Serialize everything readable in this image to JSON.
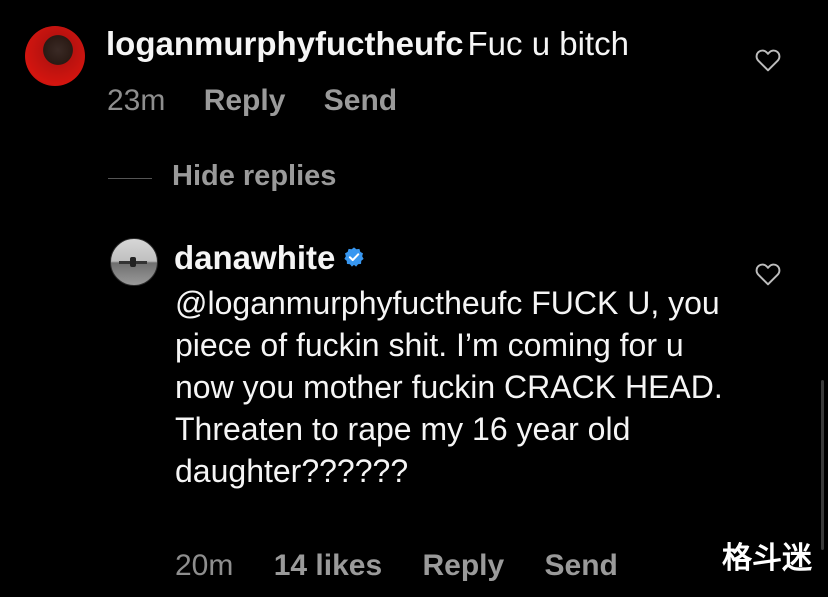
{
  "comment1": {
    "username": "loganmurphyfuctheufc",
    "text": "Fuc u bitch",
    "time": "23m",
    "reply_label": "Reply",
    "send_label": "Send"
  },
  "hide_replies_label": "Hide replies",
  "comment2": {
    "username": "danawhite",
    "verified": true,
    "text": "@loganmurphyfuctheufc FUCK U, you piece of fuckin shit. I’m coming for u now you mother fuckin CRACK HEAD. Threaten to rape my 16 year old daughter??????",
    "time": "20m",
    "likes": "14 likes",
    "reply_label": "Reply",
    "send_label": "Send"
  },
  "watermark": "格斗迷",
  "colors": {
    "background": "#000000",
    "primary_text": "#f5f5f5",
    "secondary_text": "#9a9a9a",
    "verified_blue": "#3897f0"
  }
}
